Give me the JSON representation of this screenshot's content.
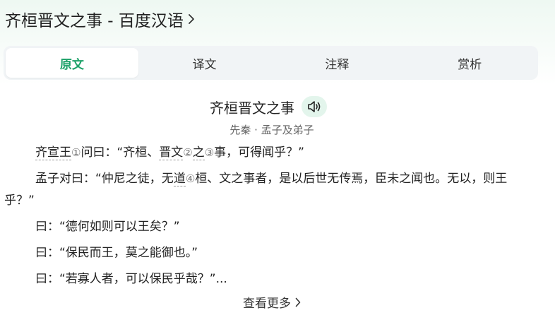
{
  "header": {
    "title": "齐桓晋文之事 - 百度汉语"
  },
  "tabs": [
    {
      "label": "原文",
      "active": true
    },
    {
      "label": "译文",
      "active": false
    },
    {
      "label": "注释",
      "active": false
    },
    {
      "label": "赏析",
      "active": false
    }
  ],
  "poem": {
    "title": "齐桓晋文之事",
    "author_line": "先秦 · 孟子及弟子",
    "p1": {
      "a": "齐宣王",
      "r1": "①",
      "b": "问曰：“齐桓、",
      "c": "晋文",
      "r2": "②",
      "d": "之",
      "r3": "③",
      "e": "事，可得闻乎？”"
    },
    "p2": {
      "a": "孟子对曰：“仲尼之徒，无",
      "b": "道",
      "r4": "④",
      "c": "桓、文之事者，是以后世无传焉，臣未之闻也。无以，则王乎？”"
    },
    "p3": "曰：“德何如则可以王矣？”",
    "p4": "曰：“保民而王，莫之能御也。”",
    "p5": "曰：“若寡人者，可以保民乎哉？”..."
  },
  "more_label": "查看更多",
  "colors": {
    "accent": "#1fa26a",
    "tab_bg": "#f1f4f6",
    "audio_bg": "#e3f5ec"
  },
  "icons": {
    "header": "chevron-right-icon",
    "audio": "speaker-icon",
    "more": "chevron-right-icon"
  }
}
